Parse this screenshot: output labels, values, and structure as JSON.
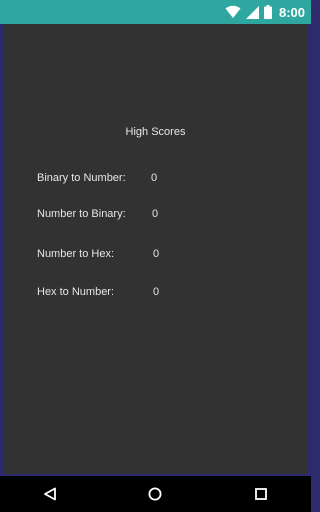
{
  "status_bar": {
    "time": "8:00",
    "icons": [
      "wifi-icon",
      "cellular-signal-icon",
      "battery-icon"
    ]
  },
  "screen": {
    "title": "High Scores",
    "scores": [
      {
        "label": "Binary to Number:",
        "value": "0"
      },
      {
        "label": "Number to Binary:",
        "value": "0"
      },
      {
        "label": "Number to Hex:",
        "value": "0"
      },
      {
        "label": "Hex to Number:",
        "value": "0"
      }
    ]
  },
  "nav_bar": {
    "buttons": [
      "back-icon",
      "home-icon",
      "recents-icon"
    ]
  },
  "colors": {
    "status_bar": "#2ea7a0",
    "background": "#323232",
    "frame": "#2e2a6e",
    "text": "#e6e6e6"
  }
}
